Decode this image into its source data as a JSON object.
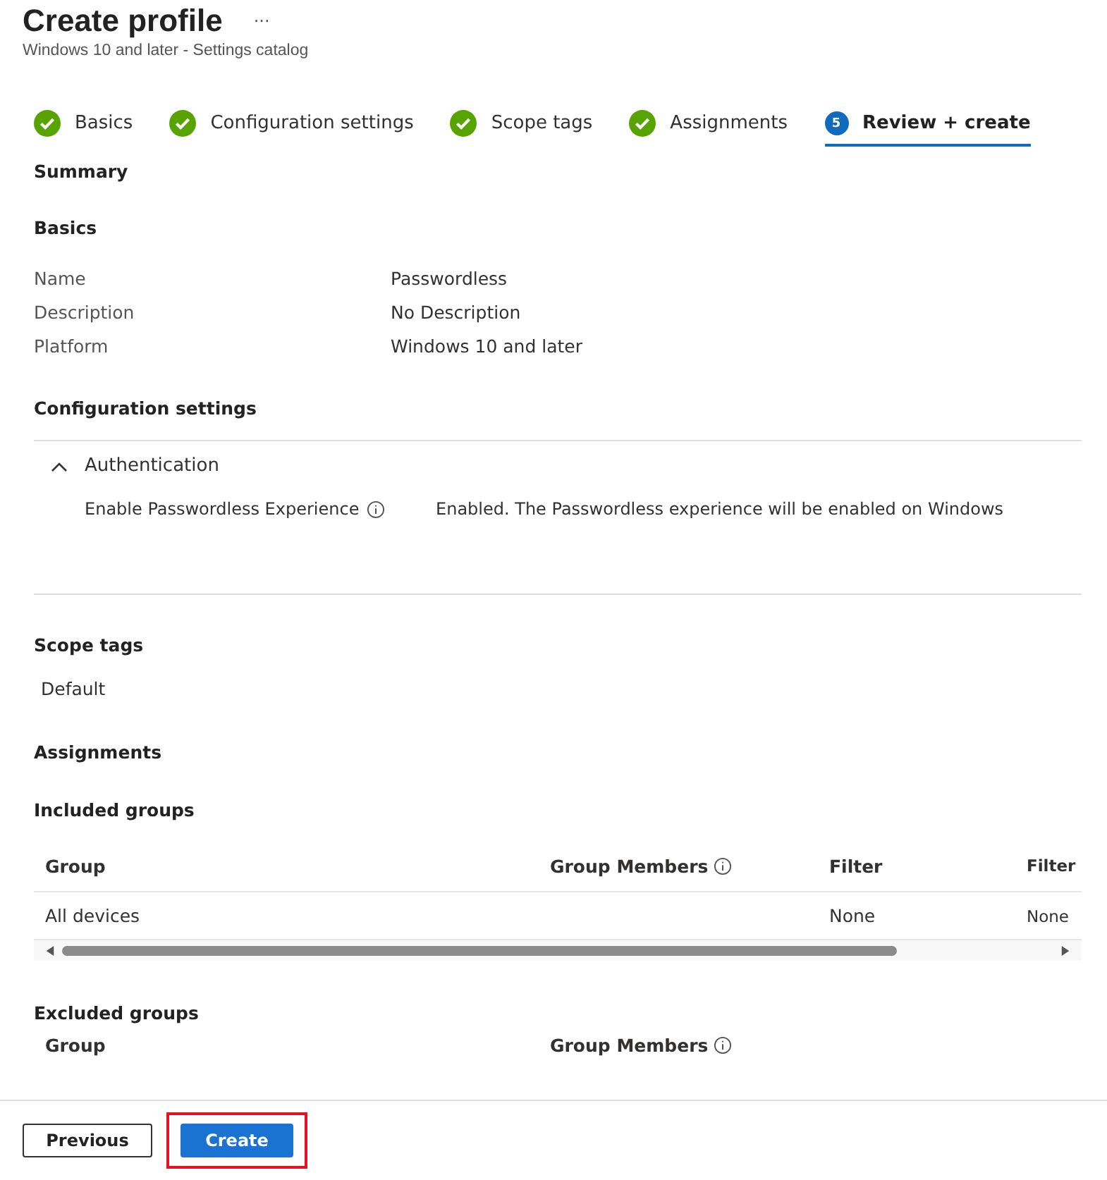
{
  "header": {
    "title": "Create profile",
    "more": "···",
    "subtitle": "Windows 10 and later - Settings catalog"
  },
  "steps": [
    {
      "kind": "done",
      "label": "Basics",
      "selected": false
    },
    {
      "kind": "done",
      "label": "Configuration settings",
      "selected": false
    },
    {
      "kind": "done",
      "label": "Scope tags",
      "selected": false
    },
    {
      "kind": "done",
      "label": "Assignments",
      "selected": false
    },
    {
      "kind": "current",
      "number": "5",
      "label": "Review + create",
      "selected": true
    }
  ],
  "summary_title": "Summary",
  "basics": {
    "title": "Basics",
    "rows": [
      {
        "label": "Name",
        "value": "Passwordless"
      },
      {
        "label": "Description",
        "value": "No Description"
      },
      {
        "label": "Platform",
        "value": "Windows 10 and later"
      }
    ]
  },
  "configuration": {
    "title": "Configuration settings",
    "group": {
      "label": "Authentication",
      "expanded": true,
      "settings": [
        {
          "name": "Enable Passwordless Experience",
          "value": "Enabled. The Passwordless experience will be enabled on Windows"
        }
      ]
    }
  },
  "scope_tags": {
    "title": "Scope tags",
    "values": [
      "Default"
    ]
  },
  "assignments": {
    "title": "Assignments",
    "included": {
      "title": "Included groups",
      "columns": [
        {
          "label": "Group",
          "info": false
        },
        {
          "label": "Group Members",
          "info": true
        },
        {
          "label": "Filter",
          "info": false
        },
        {
          "label": "Filter"
        }
      ],
      "rows": [
        [
          "All devices",
          "",
          "None",
          "None"
        ]
      ]
    },
    "excluded": {
      "title": "Excluded groups",
      "columns": [
        {
          "label": "Group",
          "info": false
        },
        {
          "label": "Group Members",
          "info": true
        }
      ]
    }
  },
  "footer": {
    "buttons": [
      {
        "label": "Previous",
        "kind": "secondary",
        "highlighted": false
      },
      {
        "label": "Create",
        "kind": "primary",
        "highlighted": true
      }
    ]
  }
}
